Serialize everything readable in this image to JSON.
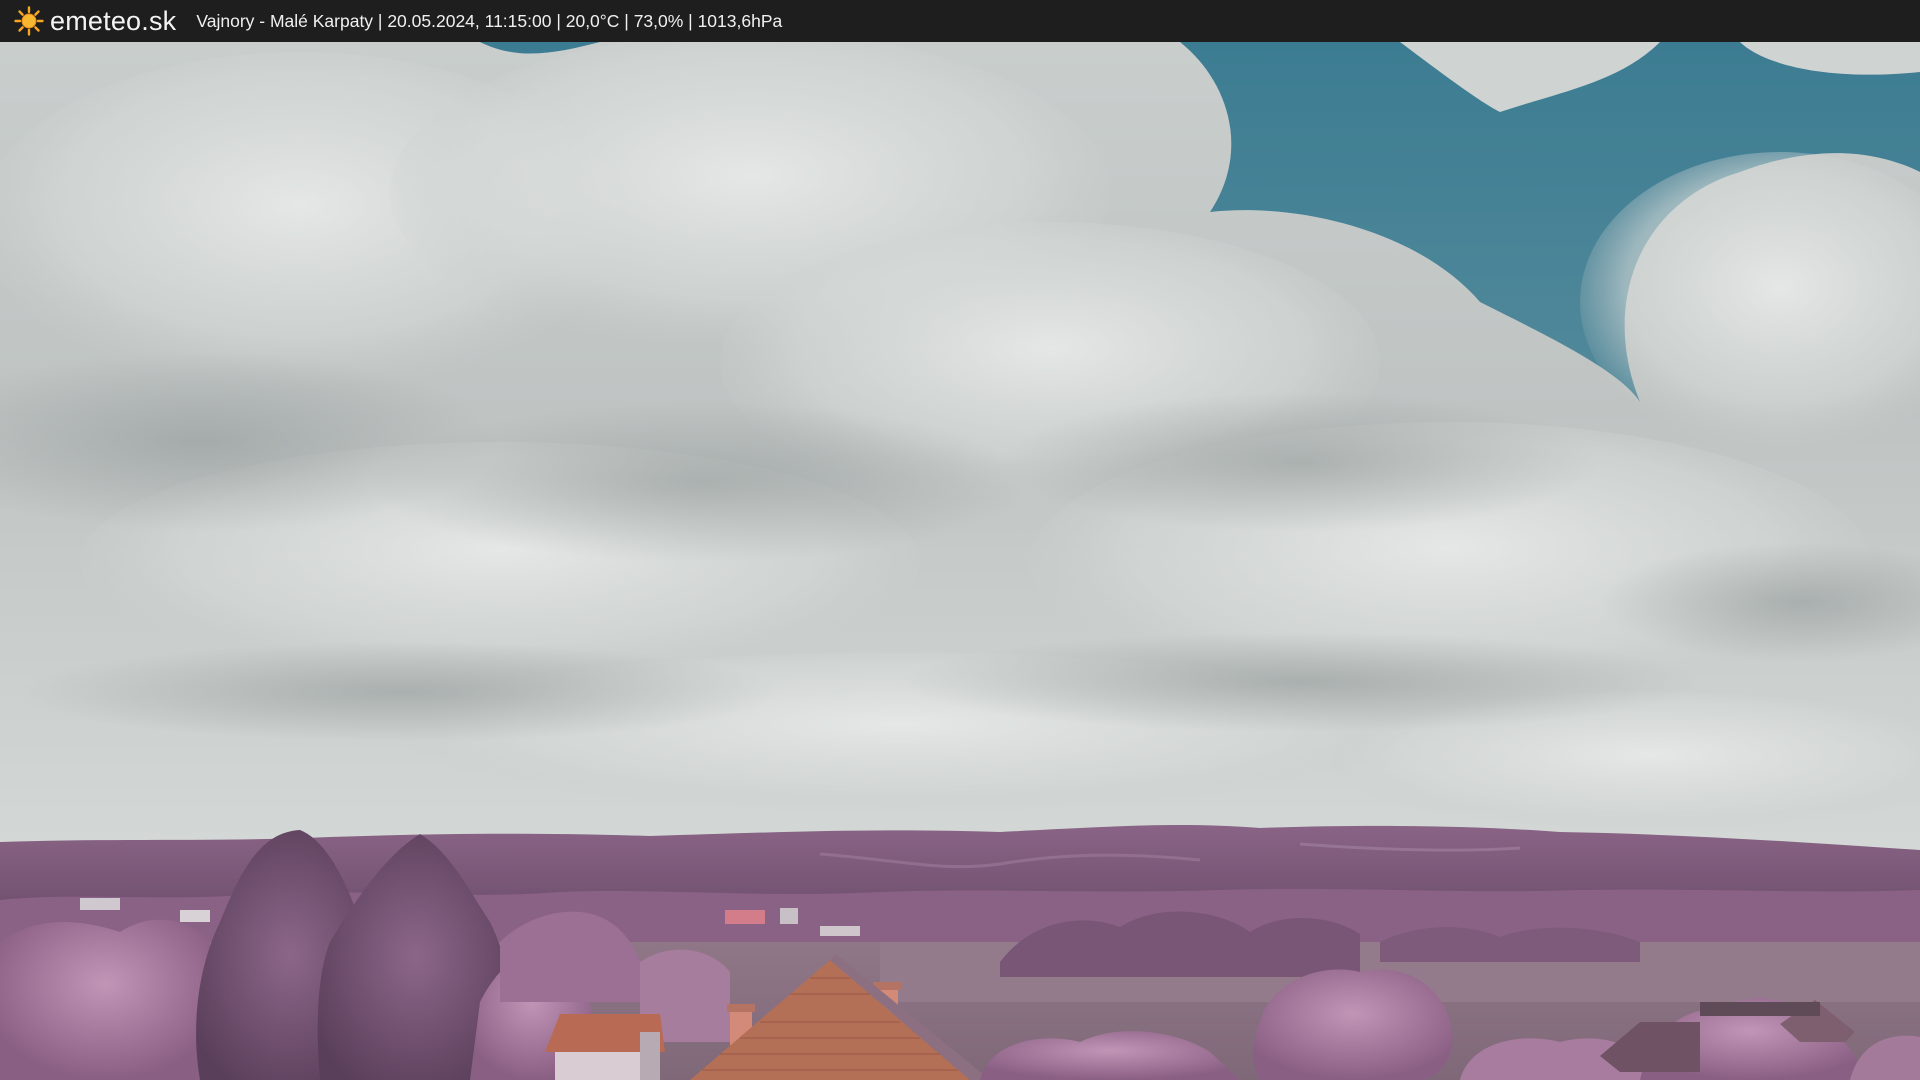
{
  "header": {
    "logo_icon": "sun-icon",
    "site_name": "emeteo.sk",
    "caption": "Vajnory - Malé Karpaty | 20.05.2024, 11:15:00 | 20,0°C | 73,0% | 1013,6hPa"
  },
  "scene": {
    "description_icon": "webcam-image",
    "colors": {
      "sky_blue": "#3f7f93",
      "cloud": "#d6dad8",
      "hills": "#7d5a7a",
      "foliage": "#a8799c",
      "field": "#8c7485",
      "roof": "#b06a52"
    }
  }
}
